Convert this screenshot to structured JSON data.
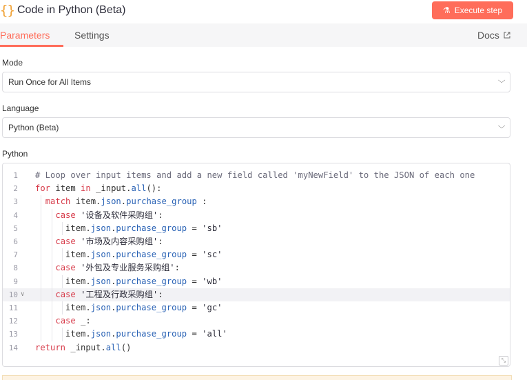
{
  "header": {
    "icon": "curly-braces-icon",
    "icon_glyph": "{}",
    "title": "Code in Python (Beta)",
    "execute_label": "Execute step"
  },
  "tabs": {
    "parameters": "Parameters",
    "settings": "Settings",
    "docs": "Docs"
  },
  "mode": {
    "label": "Mode",
    "value": "Run Once for All Items"
  },
  "language": {
    "label": "Language",
    "value": "Python (Beta)"
  },
  "editor": {
    "label": "Python",
    "lines": [
      "# Loop over input items and add a new field called 'myNewField' to the JSON of each one",
      "for item in _input.all():",
      "  match item.json.purchase_group :",
      "    case '设备及软件采购组':",
      "      item.json.purchase_group = 'sb'",
      "    case '市场及内容采购组':",
      "      item.json.purchase_group = 'sc'",
      "    case '外包及专业服务采购组':",
      "      item.json.purchase_group = 'wb'",
      "    case '工程及行政采购组':",
      "      item.json.purchase_group = 'gc'",
      "    case _:",
      "      item.json.purchase_group = 'all'",
      "return _input.all()"
    ],
    "line_numbers": [
      "1",
      "2",
      "3",
      "4",
      "5",
      "6",
      "7",
      "8",
      "9",
      "10",
      "11",
      "12",
      "13",
      "14"
    ],
    "active_line": 10
  },
  "colors": {
    "accent": "#ff6d5a",
    "keyword": "#d73a49",
    "attribute": "#2962b5",
    "comment": "#6a6a7a"
  }
}
